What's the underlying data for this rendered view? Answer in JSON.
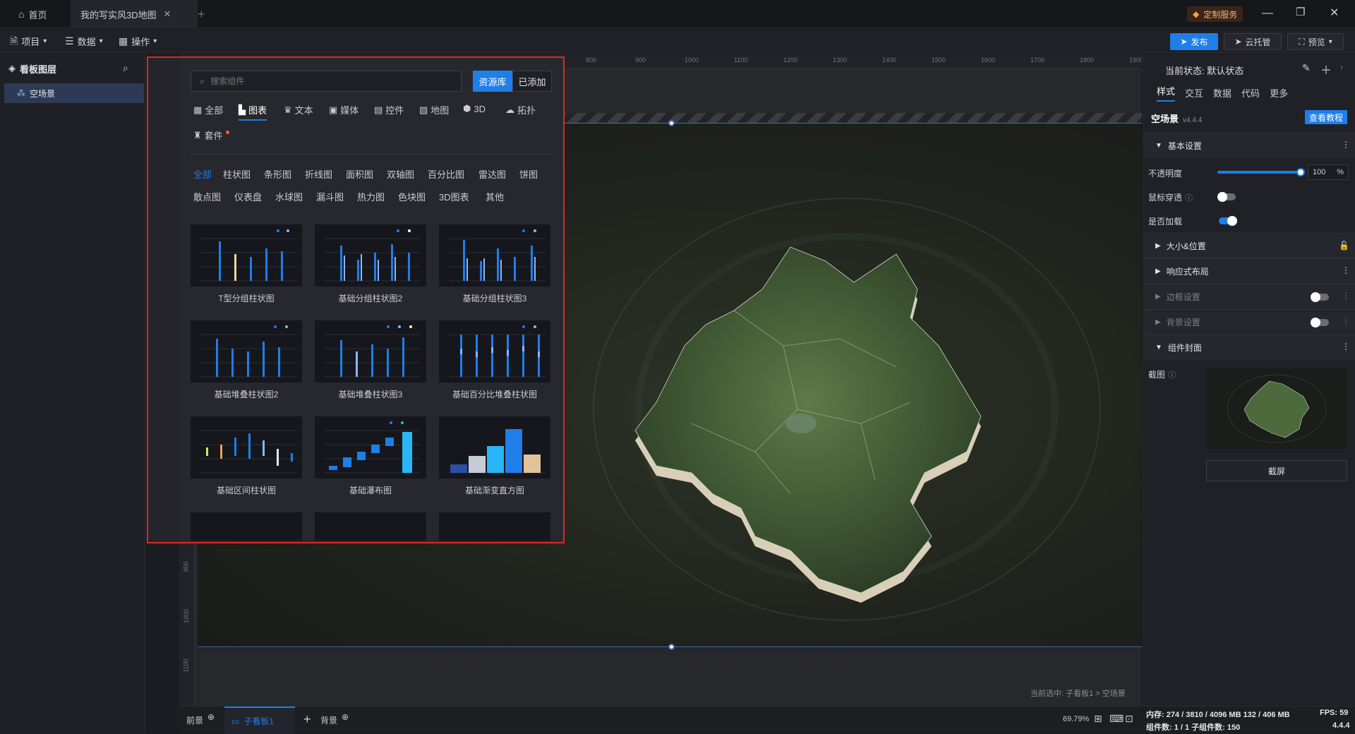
{
  "titlebar": {
    "home_tab": "首页",
    "doc_tab": "我的写实风3D地图",
    "service_badge": "定制服务"
  },
  "menubar": {
    "project": "项目",
    "data": "数据",
    "operate": "操作",
    "publish": "发布",
    "cloud": "云托管",
    "preview": "预览"
  },
  "layers": {
    "title": "看板图层",
    "items": [
      "空场景"
    ]
  },
  "rail": {
    "items": [
      "图表",
      "文本",
      "媒体",
      "控件",
      "地图",
      "3D",
      "拓扑",
      "套件"
    ]
  },
  "panel": {
    "search_placeholder": "搜索组件",
    "btn_library": "资源库",
    "btn_added": "已添加",
    "categories": [
      "全部",
      "图表",
      "文本",
      "媒体",
      "控件",
      "地图",
      "3D",
      "拓扑",
      "套件"
    ],
    "subcategories": [
      "全部",
      "柱状图",
      "条形图",
      "折线图",
      "面积图",
      "双轴图",
      "百分比图",
      "雷达图",
      "饼图",
      "散点图",
      "仪表盘",
      "水球图",
      "漏斗图",
      "热力图",
      "色块图",
      "3D图表",
      "其他"
    ],
    "cards": [
      "T型分组柱状图",
      "基础分组柱状图2",
      "基础分组柱状图3",
      "基础堆叠柱状图2",
      "基础堆叠柱状图3",
      "基础百分比堆叠柱状图",
      "基础区间柱状图",
      "基础瀑布图",
      "基础渐变直方图"
    ]
  },
  "ruler": {
    "top": [
      "800",
      "900",
      "1000",
      "1100",
      "1200",
      "1300",
      "1400",
      "1500",
      "1600",
      "1700",
      "1800",
      "1900"
    ],
    "left": [
      "900",
      "1000",
      "1100"
    ]
  },
  "canvas": {
    "selection_info": "当前选中: 子看板1 > 空场景"
  },
  "props": {
    "state_label": "当前状态: 默认状态",
    "tabs": [
      "样式",
      "交互",
      "数据",
      "代码",
      "更多"
    ],
    "component_name": "空场景",
    "version": "v4.4.4",
    "tutorial": "查看教程",
    "basic_settings": "基本设置",
    "opacity_label": "不透明度",
    "opacity_value": "100",
    "opacity_unit": "%",
    "opacity_level": 1.0,
    "mouse_through": "鼠标穿透",
    "loading": "是否加载",
    "size_position": "大小&位置",
    "responsive": "响应式布局",
    "border": "边框设置",
    "background": "背景设置",
    "cover": "组件封面",
    "screenshot_label": "截图",
    "screenshot_button": "截屏"
  },
  "bottom": {
    "foreground": "前景",
    "sub_board": "子看板1",
    "background": "背景",
    "zoom": "69.79%"
  },
  "status": {
    "memory": "内存: 274 / 3810 / 4096 MB  132 / 406 MB",
    "fps": "FPS: 59",
    "components": "组件数: 1 / 1   子组件数: 150",
    "version": "4.4.4"
  },
  "colors": {
    "accent": "#1f7ee8",
    "highlight_border": "#e0262a"
  }
}
